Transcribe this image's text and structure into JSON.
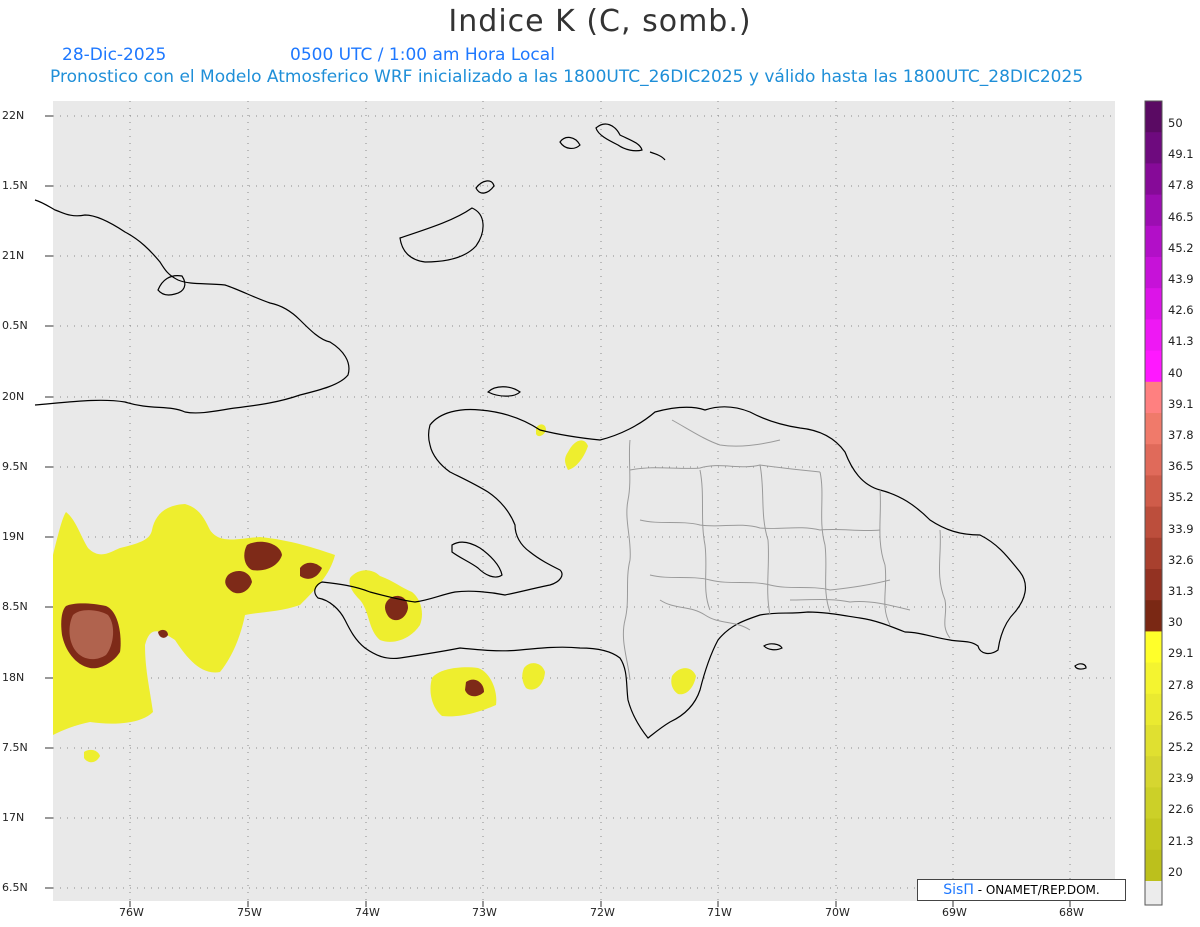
{
  "header": {
    "title": "Indice K (C, somb.)",
    "date": "28-Dic-2025",
    "valid_time": "0500 UTC / 1:00 am Hora Local",
    "model_line": "Pronostico con el Modelo Atmosferico WRF inicializado a las 1800UTC_26DIC2025 y válido hasta las  1800UTC_28DIC2025"
  },
  "axes": {
    "lat_labels": [
      "22N",
      "1.5N",
      "21N",
      "0.5N",
      "20N",
      "9.5N",
      "19N",
      "8.5N",
      "18N",
      "7.5N",
      "17N",
      "6.5N"
    ],
    "lon_labels": [
      "76W",
      "75W",
      "74W",
      "73W",
      "72W",
      "71W",
      "70W",
      "69W",
      "68W"
    ]
  },
  "colorbar": {
    "labels": [
      "50",
      "49.1",
      "47.8",
      "46.5",
      "45.2",
      "43.9",
      "42.6",
      "41.3",
      "40",
      "39.1",
      "37.8",
      "36.5",
      "35.2",
      "33.9",
      "32.6",
      "31.3",
      "30",
      "29.1",
      "27.8",
      "26.5",
      "25.2",
      "23.9",
      "22.6",
      "21.3",
      "20"
    ],
    "colors": [
      "#5a0a63",
      "#6e0a7e",
      "#860a98",
      "#9c0db2",
      "#b20fc8",
      "#c612d8",
      "#dc14e8",
      "#ee18f4",
      "#ff18ff",
      "#ff8080",
      "#f07a6a",
      "#e06a5a",
      "#cf5c4a",
      "#bc4e3c",
      "#a8402e",
      "#933222",
      "#7a2814",
      "#ffff2a",
      "#f4f430",
      "#eaea30",
      "#e0e030",
      "#d6d630",
      "#ccd028",
      "#c4c820",
      "#bcc01c"
    ],
    "below_color": "#ececec"
  },
  "credit": {
    "brand": "SisΠ",
    "text": " - ONAMET/REP.DOM."
  },
  "colors": {
    "background": "#e9e9e9",
    "coast": "#000000",
    "province_border": "#9a9a9a",
    "grid": "#8c8c8c"
  }
}
